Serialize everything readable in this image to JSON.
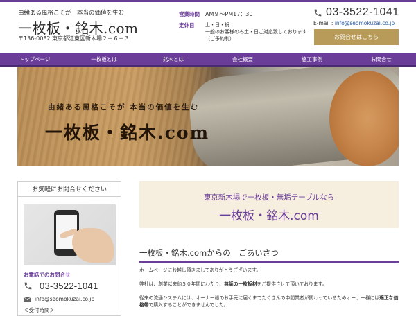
{
  "header": {
    "tagline": "由緒ある風格こそが　本当の価値を生む",
    "site_title": "一枚板・銘木.com",
    "address": "〒136-0082 東京都江東区新木場２－６－３",
    "hours_label": "営業時間",
    "hours_value": "AM９～PM17：30",
    "holiday_label": "定休日",
    "holiday_line1": "土・日・祝",
    "holiday_line2": "一般のお客様のみ土・日ご対応致しております",
    "holiday_line3": "（ご予約制）",
    "phone": "03-3522-1041",
    "email_label": "E-mail :",
    "email": "info@seomokuzai.co.jp",
    "contact_button": "お問合せはこちら"
  },
  "nav": {
    "items": [
      "トップページ",
      "一枚板とは",
      "銘木とは",
      "会社概要",
      "施工事例",
      "お問合せ"
    ]
  },
  "hero": {
    "tagline": "由緒ある風格こそが 本当の価値を生む",
    "title": "一枚板・銘木.com"
  },
  "sidebar": {
    "title": "お気軽にお問合せください",
    "phone_label": "お電話でのお問合せ",
    "phone": "03-3522-1041",
    "email": "info@seomokuzai.co.jp",
    "hours_label": "＜受付時間＞"
  },
  "main": {
    "highlight_sub": "東京新木場で一枚板・無垢テーブルなら",
    "highlight_main": "一枚板・銘木.com",
    "greeting_heading": "一枚板・銘木.comからの　ごあいさつ",
    "p1": "ホームページにお越し頂きましてありがとうございます。",
    "p2_a": "弊社は、創業以来約５０年間にわたり、",
    "p2_b": "無垢の一枚板材",
    "p2_c": "をご提供させて頂いております。",
    "p3_a": "従来の流通システムには、オーナー様のお手元に届くまでたくさんの中間業者が関わっているためオーナー様には",
    "p3_b": "適正な価格帯",
    "p3_c": "で購入することができませんでした。"
  },
  "colors": {
    "accent": "#6a3d98",
    "button": "#b89b58",
    "highlight_bg": "#f6eedf"
  }
}
